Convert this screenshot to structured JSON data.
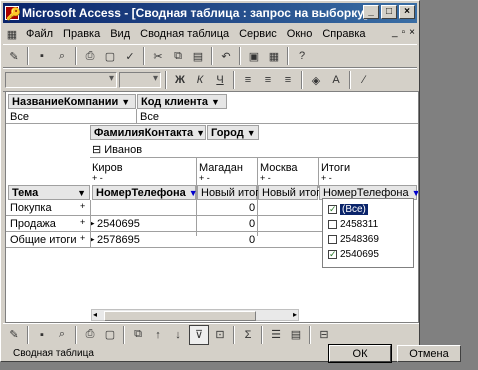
{
  "window": {
    "title": "Microsoft Access - [Сводная таблица : запрос на выборку]",
    "min": "_",
    "max": "□",
    "close": "×"
  },
  "menu": [
    "Файл",
    "Правка",
    "Вид",
    "Сводная таблица",
    "Сервис",
    "Окно",
    "Справка"
  ],
  "mdi": {
    "min": "_",
    "restore": "▫",
    "close": "×"
  },
  "format_toolbar": {
    "bold": "Ж",
    "italic": "К",
    "underline": "Ч",
    "font_color": "A"
  },
  "pivot": {
    "filter_fields": [
      {
        "label": "НазваниеКомпании",
        "value": "Все"
      },
      {
        "label": "Код клиента",
        "value": "Все"
      }
    ],
    "column_fields": [
      "ФамилияКонтакта",
      "Город"
    ],
    "contact_group": "⊟ Иванов",
    "cities": [
      {
        "name": "Киров",
        "expand": "+ -"
      },
      {
        "name": "Магадан",
        "expand": "+ -"
      },
      {
        "name": "Москва",
        "expand": "+ -"
      },
      {
        "name": "Итоги",
        "expand": "+ -"
      }
    ],
    "row_field": "Тема",
    "data_headers": [
      "НомерТелефона",
      "Новый итог",
      "Новый итог",
      "НомерТелефона"
    ],
    "rows": [
      {
        "label": "Покупка",
        "expand": "+",
        "values": [
          "",
          "",
          "0",
          ""
        ]
      },
      {
        "label": "Продажа",
        "expand": "+",
        "values": [
          "2540695",
          "",
          "0",
          ""
        ]
      },
      {
        "label": "Общие итоги",
        "expand": "+",
        "values": [
          "2578695",
          "",
          "0",
          ""
        ]
      }
    ]
  },
  "filter_popup": {
    "items": [
      {
        "label": "(Все)",
        "checked": true
      },
      {
        "label": "2458311",
        "checked": false
      },
      {
        "label": "2548369",
        "checked": false
      },
      {
        "label": "2540695",
        "checked": true
      }
    ]
  },
  "status": "Сводная таблица",
  "buttons": {
    "ok": "ОК",
    "cancel": "Отмена"
  },
  "colors": {
    "title_start": "#0a246a",
    "title_end": "#3a6ea5",
    "face": "#d4d0c8",
    "selection": "#0a246a"
  }
}
